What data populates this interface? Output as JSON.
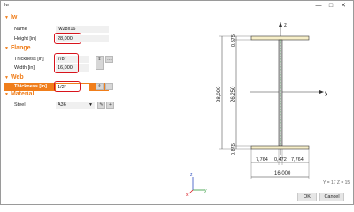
{
  "window": {
    "title": "Iw",
    "minimize": "—",
    "maximize": "□",
    "close": "✕"
  },
  "sections": {
    "iw": "Iw",
    "flange": "Flange",
    "web": "Web",
    "material": "Material"
  },
  "iw": {
    "name_label": "Name",
    "name_value": "Iw28x16",
    "height_label": "Height [in]",
    "height_value": "28,000"
  },
  "flange": {
    "thickness_label": "Thickness [in]",
    "thickness_value": "7/8\"",
    "width_label": "Width [in]",
    "width_value": "16,000"
  },
  "web": {
    "thickness_label": "Thickness [in]",
    "thickness_value": "1/2\""
  },
  "material": {
    "steel_label": "Steel",
    "steel_value": "A36"
  },
  "drawing": {
    "z_axis": "z",
    "y_axis": "y",
    "dim_height": "28,000",
    "dim_web_height": "26,250",
    "dim_flange_top": "0,875",
    "dim_flange_bottom": "0,875",
    "dim_left_overhang": "7,764",
    "dim_web": "0,472",
    "dim_right_overhang": "7,764",
    "dim_width": "16,000",
    "axes_x": "x",
    "axes_y": "y",
    "axes_z": "z"
  },
  "status": {
    "coords": "Y = 17  Z = 15"
  },
  "buttons": {
    "ok": "OK",
    "cancel": "Cancel"
  },
  "colors": {
    "accent": "#f07e1b",
    "highlight": "#d8141c",
    "axis_blue": "#2f4fc0",
    "axis_green": "#2f9a3a"
  }
}
